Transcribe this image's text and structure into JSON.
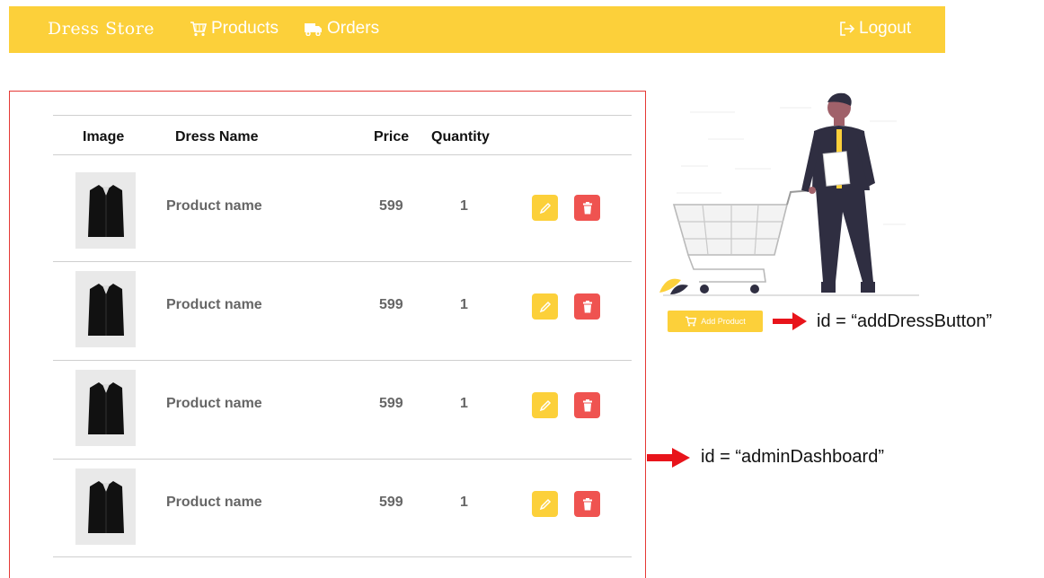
{
  "navbar": {
    "brand": "Dress Store",
    "products_label": "Products",
    "orders_label": "Orders",
    "logout_label": "Logout"
  },
  "table": {
    "headers": [
      "Image",
      "Dress Name",
      "Price",
      "Quantity"
    ],
    "rows": [
      {
        "name": "Product name",
        "price": "599",
        "quantity": "1"
      },
      {
        "name": "Product name",
        "price": "599",
        "quantity": "1"
      },
      {
        "name": "Product name",
        "price": "599",
        "quantity": "1"
      },
      {
        "name": "Product name",
        "price": "599",
        "quantity": "1"
      }
    ]
  },
  "add_product_button": "Add Product",
  "annotations": {
    "add_button_id": "id = “addDressButton”",
    "dashboard_id": "id = “adminDashboard”"
  },
  "colors": {
    "accent": "#fcd03a",
    "delete": "#ef5350",
    "annotation_arrow": "#e8141b",
    "panel_border": "#e53935"
  }
}
